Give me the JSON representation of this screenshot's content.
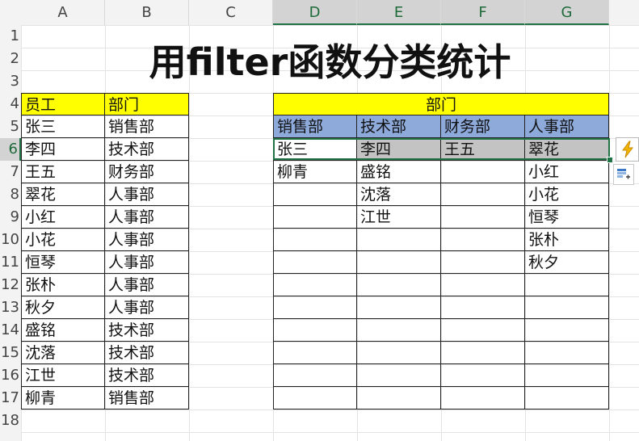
{
  "columns": [
    "A",
    "B",
    "C",
    "D",
    "E",
    "F",
    "G"
  ],
  "rows": [
    "1",
    "2",
    "3",
    "4",
    "5",
    "6",
    "7",
    "8",
    "9",
    "10",
    "11",
    "12",
    "13",
    "14",
    "15",
    "16",
    "17",
    "18"
  ],
  "title": "用filter函数分类统计",
  "left_table": {
    "headers": [
      "员工",
      "部门"
    ],
    "rows": [
      [
        "张三",
        "销售部"
      ],
      [
        "李四",
        "技术部"
      ],
      [
        "王五",
        "财务部"
      ],
      [
        "翠花",
        "人事部"
      ],
      [
        "小红",
        "人事部"
      ],
      [
        "小花",
        "人事部"
      ],
      [
        "恒琴",
        "人事部"
      ],
      [
        "张朴",
        "人事部"
      ],
      [
        "秋夕",
        "人事部"
      ],
      [
        "盛铭",
        "技术部"
      ],
      [
        "沈落",
        "技术部"
      ],
      [
        "江世",
        "技术部"
      ],
      [
        "柳青",
        "销售部"
      ]
    ]
  },
  "right_table": {
    "group_header": "部门",
    "headers": [
      "销售部",
      "技术部",
      "财务部",
      "人事部"
    ],
    "rows": [
      [
        "张三",
        "李四",
        "王五",
        "翠花"
      ],
      [
        "柳青",
        "盛铭",
        "",
        "小红"
      ],
      [
        "",
        "沈落",
        "",
        "小花"
      ],
      [
        "",
        "江世",
        "",
        "恒琴"
      ],
      [
        "",
        "",
        "",
        "张朴"
      ],
      [
        "",
        "",
        "",
        "秋夕"
      ],
      [
        "",
        "",
        "",
        ""
      ],
      [
        "",
        "",
        "",
        ""
      ],
      [
        "",
        "",
        "",
        ""
      ],
      [
        "",
        "",
        "",
        ""
      ],
      [
        "",
        "",
        "",
        ""
      ],
      [
        "",
        "",
        "",
        ""
      ]
    ]
  },
  "icons": {
    "flash_fill": "lightning-icon",
    "autofill_options": "autofill-options-icon"
  },
  "colors": {
    "header_yellow": "#ffff00",
    "header_blue": "#8eaadb",
    "spill_gray": "#c3c3c3",
    "selection_green": "#217346"
  }
}
